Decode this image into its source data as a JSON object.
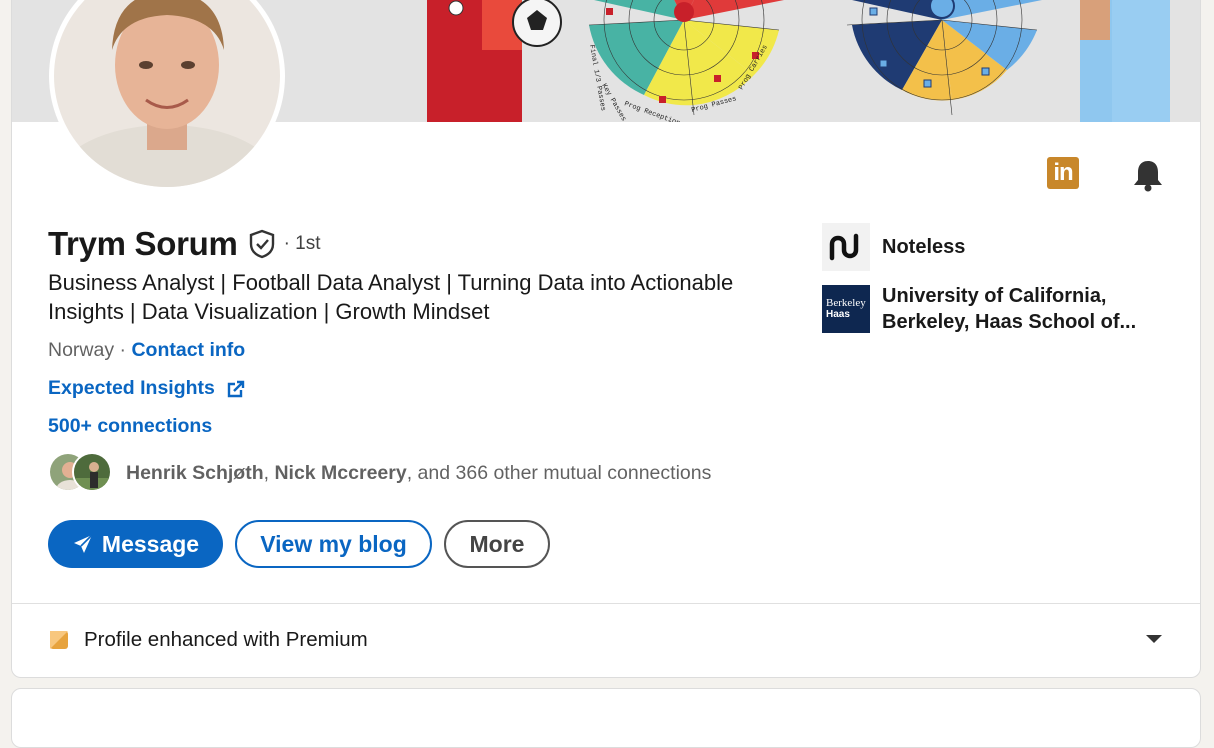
{
  "profile": {
    "name": "Trym Sorum",
    "degree": "· 1st",
    "headline": "Business Analyst | Football Data Analyst | Turning Data into Actionable Insights | Data Visualization | Growth Mindset",
    "location": "Norway",
    "location_sep": " · ",
    "contact_info": "Contact info",
    "website": "Expected Insights",
    "connections": "500+ connections"
  },
  "mutual": {
    "name1": "Henrik Schjøth",
    "sep1": ", ",
    "name2": "Nick Mccreery",
    "rest": ", and 366 other mutual connections"
  },
  "actions": {
    "message": "Message",
    "blog": "View my blog",
    "more": "More"
  },
  "orgs": [
    {
      "name": "Noteless",
      "logo_text": "ꓵ"
    },
    {
      "name": "University of California, Berkeley, Haas School of...",
      "logo_text_1": "Berkeley",
      "logo_text_2": "Haas"
    }
  ],
  "banner": {
    "chart_labels": [
      "Prog Receptions",
      "Prog Passes",
      "Key Passes",
      "Prog Carries",
      "Final 1/3 Passes"
    ]
  },
  "premium": {
    "label": "Profile enhanced with Premium"
  },
  "icons": {
    "linkedin": "in",
    "bell": "bell-icon",
    "verified": "shield-check-icon",
    "external": "external-link-icon",
    "send": "send-icon",
    "premium": "premium-badge-icon",
    "chevron": "chevron-down-icon"
  },
  "colors": {
    "link": "#0a66c2",
    "premium_gold": "#c8872a",
    "card_bg": "#ffffff",
    "page_bg": "#f4f2ee"
  }
}
